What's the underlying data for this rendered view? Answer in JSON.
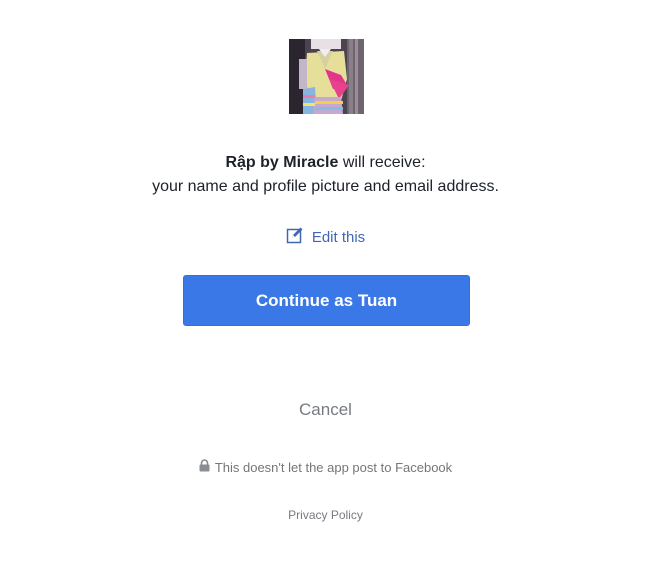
{
  "dialog": {
    "app_name": "Rập by Miracle",
    "receive_suffix": " will receive:",
    "scopes": "your name and profile picture and email address.",
    "edit_label": "Edit this",
    "continue_label": "Continue as Tuan",
    "cancel_label": "Cancel",
    "notice": "This doesn't let the app post to Facebook",
    "privacy_label": "Privacy Policy"
  },
  "colors": {
    "primary_button": "#3b78e7",
    "link": "#4267b2",
    "muted_text": "#777a80"
  },
  "icons": {
    "edit": "edit-icon",
    "lock": "lock-icon"
  }
}
